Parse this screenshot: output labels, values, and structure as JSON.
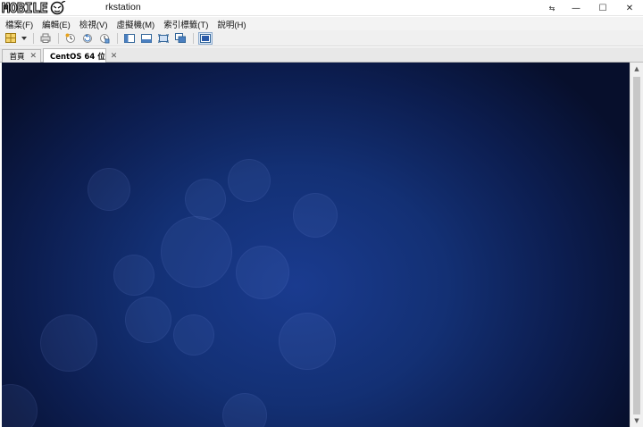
{
  "window": {
    "logo_text": "MOBILE",
    "title": "rkstation",
    "controls": {
      "restore": "⇆",
      "minimize": "—",
      "maximize": "☐",
      "close": "✕"
    }
  },
  "menu": {
    "items": [
      {
        "label": "檔案(F)"
      },
      {
        "label": "編輯(E)"
      },
      {
        "label": "檢視(V)"
      },
      {
        "label": "虛擬機(M)"
      },
      {
        "label": "索引標籤(T)"
      },
      {
        "label": "說明(H)"
      }
    ]
  },
  "toolbar": {
    "icons": [
      "library-icon",
      "dropdown-icon",
      "print-icon",
      "snapshot-icon",
      "revert-snapshot-icon",
      "snapshot-manager-icon",
      "sidebar-icon",
      "thumbnail-icon",
      "fullscreen-icon",
      "unity-icon",
      "console-view-icon"
    ]
  },
  "tabs": [
    {
      "label": "首頁",
      "close": "✕",
      "selected": false
    },
    {
      "label": "CentOS 64 位",
      "close": "✕",
      "selected": true
    }
  ],
  "scrollbar": {
    "up": "▲",
    "down": "▼"
  },
  "colors": {
    "vm_background_center": "#1a3b8f",
    "vm_background_edge": "#070f2c",
    "menu_background": "#f3f3f3"
  }
}
